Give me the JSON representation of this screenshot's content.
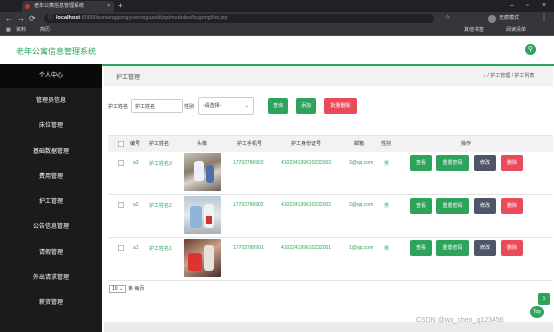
{
  "browser": {
    "tab_title": "老年公寓信息管理系统",
    "tab_close": "×",
    "new_tab": "+",
    "controls": {
      "minimize": "–",
      "maximize": "▫",
      "close": "×"
    },
    "nav": {
      "back": "←",
      "forward": "→",
      "reload": "⟳"
    },
    "url_host": "localhost",
    "url_path": ":8080/laonianggongyuxinxiguanli/jsp/modules/hugong/list.jsp",
    "bookmarks": [
      "资料",
      "简历"
    ],
    "bookmark_right": [
      "其他书签",
      "阅读清单"
    ],
    "profile_label": "无痕模式"
  },
  "app": {
    "title": "老年公寓信息管理系统",
    "avatar_icon": "user-icon"
  },
  "sidebar": {
    "items": [
      {
        "label": "个人中心",
        "active": true
      },
      {
        "label": "管理员信息"
      },
      {
        "label": "床位管理"
      },
      {
        "label": "基础数据管理"
      },
      {
        "label": "费用管理"
      },
      {
        "label": "护工管理"
      },
      {
        "label": "公告信息管理"
      },
      {
        "label": "请假管理"
      },
      {
        "label": "外出请求管理"
      },
      {
        "label": "薪资管理"
      }
    ]
  },
  "breadcrumb": {
    "title": "护工管理",
    "home_icon": "home-icon",
    "path": [
      "护工管理",
      "护工列表"
    ],
    "separator": "/"
  },
  "filters": {
    "name_label": "护工姓名",
    "name_placeholder": "护工姓名",
    "gender_label": "性别",
    "gender_value": "-请选择-",
    "search_label": "查询",
    "add_label": "添加",
    "batch_delete_label": "批量删除"
  },
  "table": {
    "headers": [
      "编号",
      "护工姓名",
      "头像",
      "护工手机号",
      "护工身份证号",
      "邮箱",
      "性别",
      "操作"
    ],
    "actions": [
      "查看",
      "重置密码",
      "修改",
      "删除"
    ],
    "rows": [
      {
        "id": "a3",
        "name": "护工姓名3",
        "phone": "17703786903",
        "idcard": "410224199610232003",
        "email": "3@qq.com",
        "gender": "男"
      },
      {
        "id": "a2",
        "name": "护工姓名2",
        "phone": "17703786902",
        "idcard": "410224199610232002",
        "email": "2@qq.com",
        "gender": "男"
      },
      {
        "id": "a1",
        "name": "护工姓名1",
        "phone": "17703786901",
        "idcard": "410224199610232001",
        "email": "1@qq.com",
        "gender": "男"
      }
    ]
  },
  "pager": {
    "page_size": "10",
    "suffix": "条 每页"
  },
  "to_top": "1",
  "to_top_label": "Top",
  "watermark": "CSDN @wx_chen_q123456",
  "colors": {
    "accent": "#2ea35c",
    "danger": "#e94b5b",
    "dark_button": "#4e5566",
    "sidebar": "#1b1b1b"
  }
}
